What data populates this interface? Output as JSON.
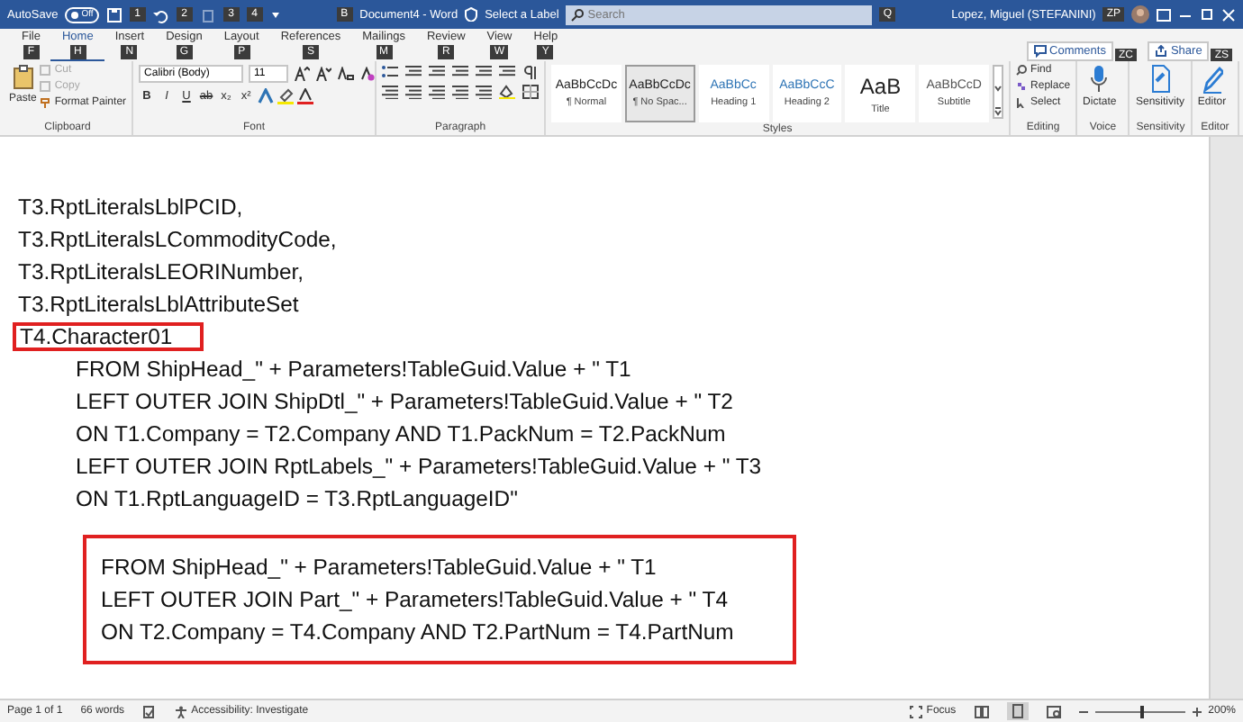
{
  "title_bar": {
    "autosave_label": "AutoSave",
    "autosave_toggle": {
      "on": false,
      "label": "Off"
    },
    "quick_access_keytips": [
      "1",
      "2",
      "3",
      "4"
    ],
    "document_title": "Document4 - Word",
    "title_keytip": "B",
    "sensitivity_label": "Select a Label",
    "search": {
      "placeholder": "Search",
      "keytip": "Q"
    },
    "user": {
      "name": "Lopez, Miguel (STEFANINI)",
      "keytip": "ZP"
    }
  },
  "tabs": [
    {
      "label": "File",
      "keytip": "F",
      "selected": false
    },
    {
      "label": "Home",
      "keytip": "H",
      "selected": true
    },
    {
      "label": "Insert",
      "keytip": "N",
      "selected": false
    },
    {
      "label": "Design",
      "keytip": "G",
      "selected": false
    },
    {
      "label": "Layout",
      "keytip": "P",
      "selected": false
    },
    {
      "label": "References",
      "keytip": "S",
      "selected": false
    },
    {
      "label": "Mailings",
      "keytip": "M",
      "selected": false
    },
    {
      "label": "Review",
      "keytip": "R",
      "selected": false
    },
    {
      "label": "View",
      "keytip": "W",
      "selected": false
    },
    {
      "label": "Help",
      "keytip": "Y",
      "selected": false
    }
  ],
  "header_buttons": [
    {
      "label": "Comments",
      "keytip": "ZC"
    },
    {
      "label": "Share",
      "keytip": "ZS"
    }
  ],
  "ribbon": {
    "clipboard": {
      "label": "Clipboard",
      "paste": "Paste",
      "items": [
        {
          "label": "Cut",
          "disabled": true
        },
        {
          "label": "Copy",
          "disabled": true
        },
        {
          "label": "Format Painter",
          "disabled": false
        }
      ]
    },
    "font": {
      "label": "Font",
      "font_name": "Calibri (Body)",
      "font_size": "11",
      "format_buttons": [
        "B",
        "I",
        "U",
        "ab",
        "x₂",
        "x²"
      ]
    },
    "paragraph": {
      "label": "Paragraph"
    },
    "styles": {
      "label": "Styles",
      "items": [
        {
          "preview": "AaBbCcDc",
          "name": "¶ Normal",
          "selected": false
        },
        {
          "preview": "AaBbCcDc",
          "name": "¶ No Spac...",
          "selected": true
        },
        {
          "preview": "AaBbCc",
          "name": "Heading 1",
          "selected": false
        },
        {
          "preview": "AaBbCcC",
          "name": "Heading 2",
          "selected": false
        },
        {
          "preview": "AaB",
          "name": "Title",
          "selected": false
        },
        {
          "preview": "AaBbCcD",
          "name": "Subtitle",
          "selected": false
        }
      ]
    },
    "editing": {
      "label": "Editing",
      "items": [
        "Find",
        "Replace",
        "Select"
      ]
    },
    "voice": {
      "label": "Voice",
      "button": "Dictate"
    },
    "sensitivity": {
      "label": "Sensitivity",
      "button": "Sensitivity"
    },
    "editor": {
      "label": "Editor",
      "button": "Editor"
    }
  },
  "document": {
    "blocks": [
      {
        "kind": "plain",
        "lines": [
          "T3.RptLiteralsLblPCID,",
          "T3.RptLiteralsLCommodityCode,",
          "T3.RptLiteralsLEORINumber,",
          "T3.RptLiteralsLblAttributeSet"
        ]
      },
      {
        "kind": "boxed",
        "lines": [
          "T4.Character01"
        ]
      },
      {
        "kind": "indented",
        "lines": [
          "FROM ShipHead_\" + Parameters!TableGuid.Value + \" T1",
          "LEFT OUTER JOIN ShipDtl_\" + Parameters!TableGuid.Value + \" T2",
          "ON T1.Company = T2.Company AND T1.PackNum = T2.PackNum",
          "LEFT OUTER JOIN RptLabels_\" + Parameters!TableGuid.Value + \" T3",
          "ON T1.RptLanguageID = T3.RptLanguageID\""
        ]
      },
      {
        "kind": "boxed-block",
        "lines": [
          "FROM ShipHead_\" + Parameters!TableGuid.Value + \" T1",
          "LEFT OUTER JOIN Part_\" + Parameters!TableGuid.Value + \" T4",
          "ON T2.Company = T4.Company AND T2.PartNum = T4.PartNum"
        ]
      }
    ]
  },
  "status_bar": {
    "page": "Page 1 of 1",
    "words": "66 words",
    "accessibility": "Accessibility: Investigate",
    "focus": "Focus",
    "zoom": {
      "level": 0.5,
      "reading": "200%"
    }
  }
}
